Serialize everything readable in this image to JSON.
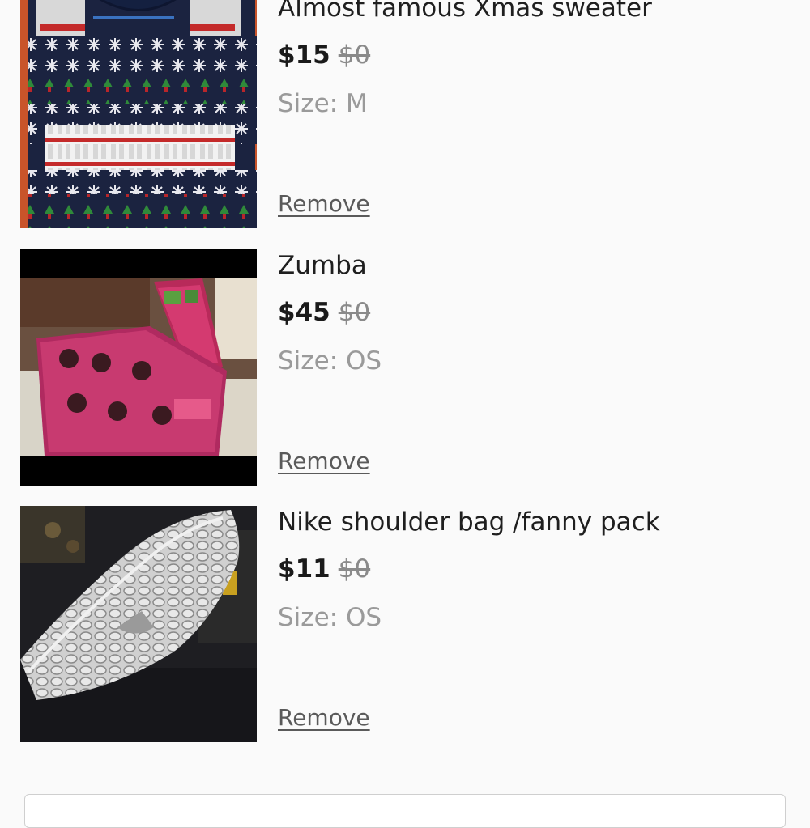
{
  "items": [
    {
      "title": "Almost famous Xmas sweater",
      "price": "$15",
      "original_price": "$0",
      "size_label": "Size:",
      "size_value": "M",
      "remove_label": "Remove"
    },
    {
      "title": "Zumba",
      "price": "$45",
      "original_price": "$0",
      "size_label": "Size:",
      "size_value": "OS",
      "remove_label": "Remove"
    },
    {
      "title": "Nike shoulder bag /fanny pack",
      "price": "$11",
      "original_price": "$0",
      "size_label": "Size:",
      "size_value": "OS",
      "remove_label": "Remove"
    }
  ]
}
